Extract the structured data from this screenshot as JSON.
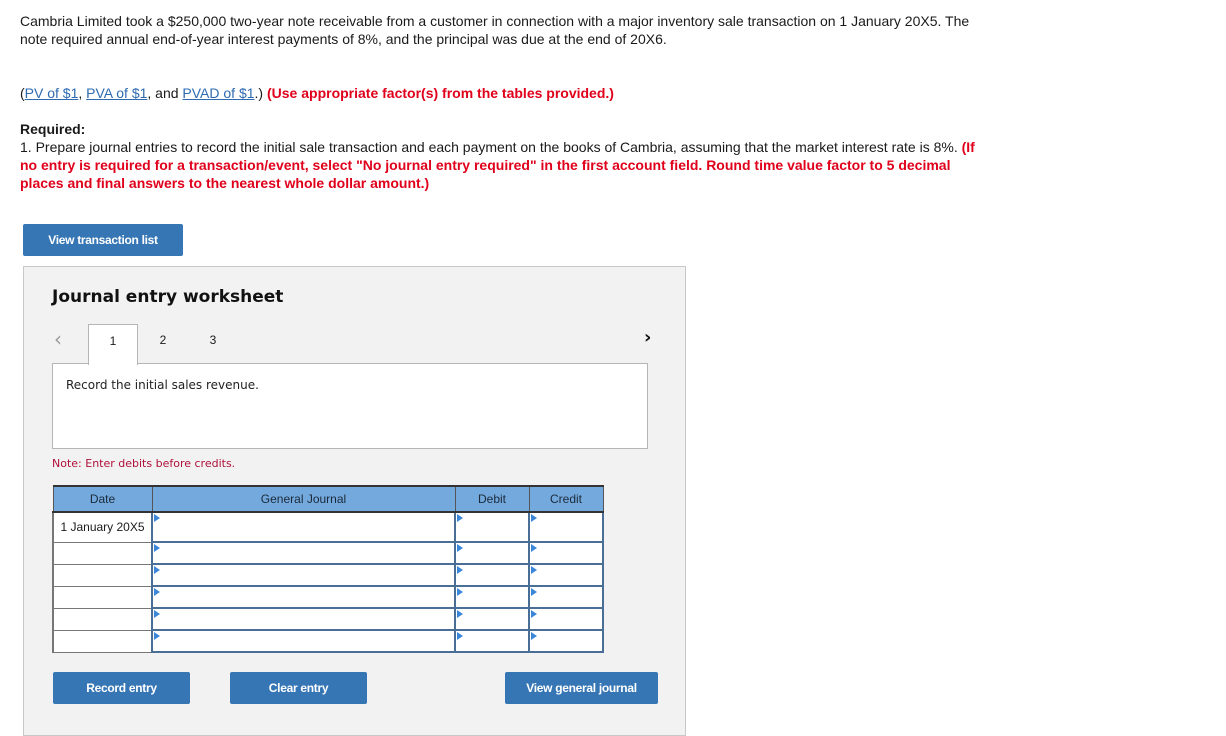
{
  "question": {
    "intro": "Cambria Limited took a $250,000 two-year note receivable from a customer in connection with a major inventory sale transaction on 1 January 20X5. The note required annual end-of-year interest payments of 8%, and the principal was due at the end of 20X6.",
    "refs": {
      "open_paren": "(",
      "pv": "PV of $1",
      "sep1": ", ",
      "pva": "PVA of $1",
      "sep2": ", and ",
      "pvad": "PVAD of $1",
      "close": ".) ",
      "instruction": "(Use appropriate factor(s) from the tables provided.)"
    },
    "required_label": "Required:",
    "required_text": "1. Prepare journal entries to record the initial sale transaction and each payment on the books of Cambria, assuming that the market interest rate is 8%. ",
    "required_instruction": "(If no entry is required for a transaction/event, select \"No journal entry required\" in the first account field. Round time value factor to 5 decimal places and final answers to the nearest whole dollar amount.)"
  },
  "buttons": {
    "view_transaction_list": "View transaction list",
    "record_entry": "Record entry",
    "clear_entry": "Clear entry",
    "view_general_journal": "View general journal"
  },
  "worksheet": {
    "title": "Journal entry worksheet",
    "prev_icon": "‹",
    "next_icon": "›",
    "tabs": [
      "1",
      "2",
      "3"
    ],
    "active_tab": "1",
    "description": "Record the initial sales revenue.",
    "note": "Note: Enter debits before credits.",
    "table": {
      "headers": [
        "Date",
        "General Journal",
        "Debit",
        "Credit"
      ],
      "rows": [
        {
          "date": "1 January 20X5",
          "account": "",
          "debit": "",
          "credit": ""
        },
        {
          "date": "",
          "account": "",
          "debit": "",
          "credit": ""
        },
        {
          "date": "",
          "account": "",
          "debit": "",
          "credit": ""
        },
        {
          "date": "",
          "account": "",
          "debit": "",
          "credit": ""
        },
        {
          "date": "",
          "account": "",
          "debit": "",
          "credit": ""
        },
        {
          "date": "",
          "account": "",
          "debit": "",
          "credit": ""
        }
      ]
    }
  },
  "colors": {
    "button_blue": "#3676b5",
    "header_blue": "#74a9dd",
    "instruction_red": "#e0001b",
    "link_blue": "#2e6ab0"
  }
}
